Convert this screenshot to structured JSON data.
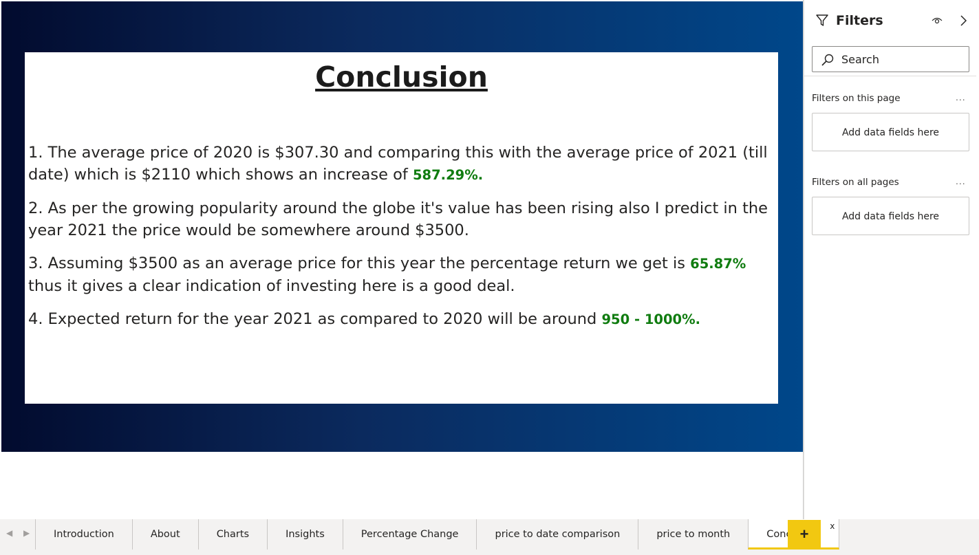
{
  "report": {
    "title": "Conclusion",
    "points": [
      {
        "text": "1. The average price of 2020 is $307.30 and comparing this with the average price of 2021 (till date) which is $2110 which shows an increase of ",
        "highlight": "587.29%.",
        "after": ""
      },
      {
        "text": "2. As per the growing popularity around the globe it's value has been rising also I predict in the year 2021 the price would be somewhere around $3500.",
        "highlight": "",
        "after": ""
      },
      {
        "text": "3. Assuming $3500 as an average price for this year the percentage return we get is ",
        "highlight": "65.87%",
        "after": " thus it gives a clear indication of investing here is a good deal."
      },
      {
        "text": "4. Expected return for the year 2021 as compared to 2020 will be around ",
        "highlight": "950 - 1000%.",
        "after": ""
      }
    ],
    "highlight_color": "#107c10"
  },
  "filters": {
    "title": "Filters",
    "search_placeholder": "Search",
    "this_page_label": "Filters on this page",
    "all_pages_label": "Filters on all pages",
    "more_label": "...",
    "dropzone_label": "Add data fields here"
  },
  "tabs": {
    "items": [
      "Introduction",
      "About",
      "Charts",
      "Insights",
      "Percentage Change",
      "price to date comparison",
      "price to month",
      "Conclusion"
    ],
    "active": "Conclusion",
    "close_label": "x",
    "add_label": "+",
    "accent_color": "#f2c811"
  },
  "icons": {
    "filter": "funnel-icon",
    "visibility": "eye-icon",
    "collapse": "chevron-right-icon",
    "search": "search-icon",
    "prev": "chevron-left-icon",
    "next": "chevron-right-icon"
  }
}
